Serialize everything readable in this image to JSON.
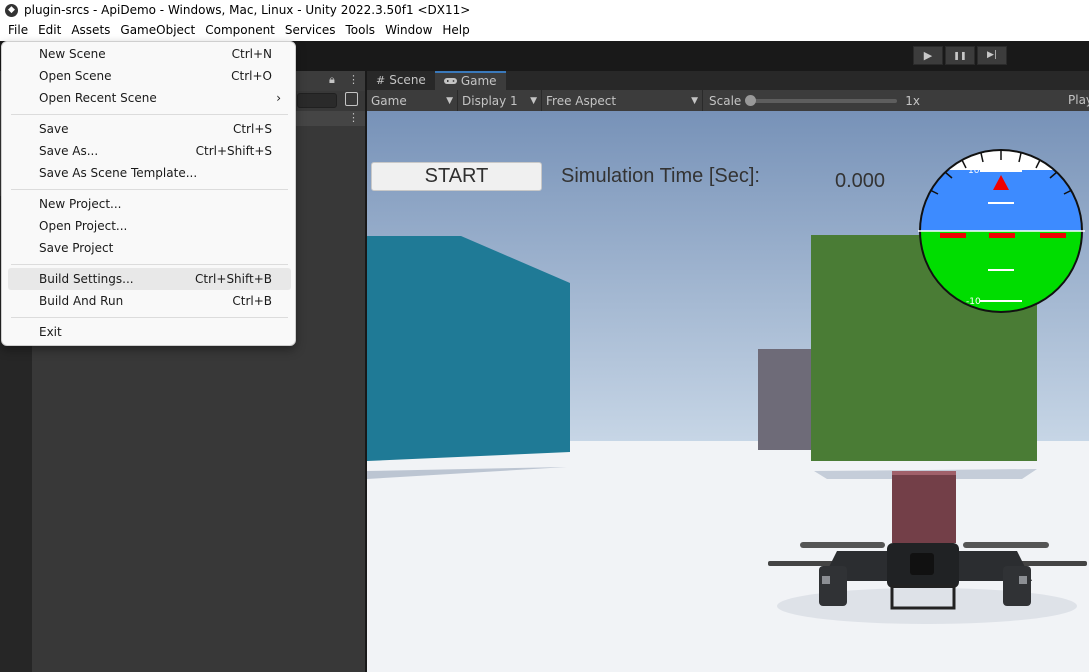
{
  "window": {
    "title": "plugin-srcs - ApiDemo - Windows, Mac, Linux - Unity 2022.3.50f1 <DX11>",
    "icon": "unity-icon"
  },
  "menubar": [
    "File",
    "Edit",
    "Assets",
    "GameObject",
    "Component",
    "Services",
    "Tools",
    "Window",
    "Help"
  ],
  "toolbar": {
    "play_icon": "▶",
    "pause_icon": "❚❚",
    "step_icon": "▶|"
  },
  "file_menu": {
    "groups": [
      [
        {
          "label": "New Scene",
          "shortcut": "Ctrl+N"
        },
        {
          "label": "Open Scene",
          "shortcut": "Ctrl+O"
        },
        {
          "label": "Open Recent Scene",
          "shortcut": "",
          "submenu": true
        }
      ],
      [
        {
          "label": "Save",
          "shortcut": "Ctrl+S"
        },
        {
          "label": "Save As...",
          "shortcut": "Ctrl+Shift+S"
        },
        {
          "label": "Save As Scene Template...",
          "shortcut": ""
        }
      ],
      [
        {
          "label": "New Project...",
          "shortcut": ""
        },
        {
          "label": "Open Project...",
          "shortcut": ""
        },
        {
          "label": "Save Project",
          "shortcut": ""
        }
      ],
      [
        {
          "label": "Build Settings...",
          "shortcut": "Ctrl+Shift+B",
          "highlighted": true
        },
        {
          "label": "Build And Run",
          "shortcut": "Ctrl+B"
        }
      ],
      [
        {
          "label": "Exit",
          "shortcut": ""
        }
      ]
    ]
  },
  "tabs": [
    {
      "label": "Scene",
      "icon": "#",
      "active": false
    },
    {
      "label": "Game",
      "icon": "gamepad-icon",
      "active": true
    }
  ],
  "gamebar": {
    "view": "Game",
    "display": "Display 1",
    "aspect": "Free Aspect",
    "scale_label": "Scale",
    "scale_value": "1x",
    "scale_fraction": 0.0,
    "play_label": "Play"
  },
  "game": {
    "start_button": "START",
    "sim_time_label": "Simulation Time [Sec]:",
    "sim_time_value": "0.000"
  },
  "attitude_indicator": {
    "top_label": "10",
    "bottom_label": "-10",
    "sky_color": "#3d8bff",
    "ground_color": "#00dd00"
  },
  "colors": {
    "accent": "#3a79bb",
    "menu_bg": "#f9f9f9",
    "editor_bg": "#383838"
  }
}
